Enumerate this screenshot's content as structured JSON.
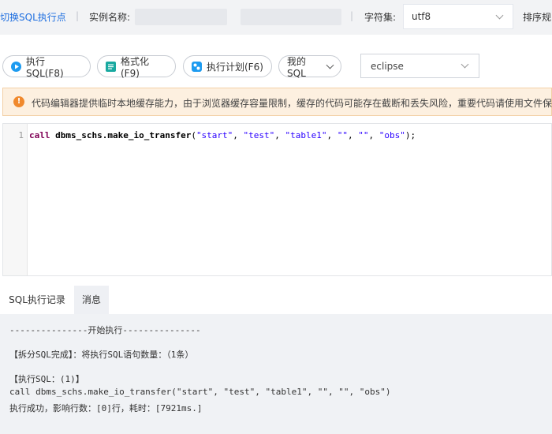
{
  "topbar": {
    "switch_link": "切换SQL执行点",
    "instance_label": "实例名称:",
    "charset_label": "字符集:",
    "charset_value": "utf8",
    "sort_label": "排序规"
  },
  "toolbar": {
    "execute": "执行SQL(F8)",
    "format": "格式化(F9)",
    "plan": "执行计划(F6)",
    "my_sql": "我的SQL",
    "theme_value": "eclipse"
  },
  "notice": {
    "text": "代码编辑器提供临时本地缓存能力，由于浏览器缓存容量限制，缓存的代码可能存在截断和丢失风险，重要代码请使用文件保"
  },
  "editor": {
    "line_number": "1",
    "code": {
      "kw": "call",
      "fn": "dbms_schs.make_io_transfer",
      "open": "(",
      "s1": "\"start\"",
      "s2": "\"test\"",
      "s3": "\"table1\"",
      "s4": "\"\"",
      "s5": "\"\"",
      "s6": "\"obs\"",
      "comma": ", ",
      "close": ");"
    }
  },
  "tabs": {
    "history": "SQL执行记录",
    "messages": "消息"
  },
  "console": {
    "line1": "---------------开始执行---------------",
    "line2": "【拆分SQL完成】：将执行SQL语句数量：（1条）",
    "line3": "【执行SQL：(1)】",
    "line4": "call dbms_schs.make_io_transfer(\"start\", \"test\", \"table1\", \"\", \"\", \"obs\")",
    "line5": "执行成功，影响行数：[0]行，耗时：[7921ms.]"
  },
  "colors": {
    "link": "#1f6fe0",
    "warning": "#f0892d",
    "execute_icon": "#1d9bf0",
    "format_icon": "#19a9a0"
  },
  "icons": [
    "play-icon",
    "format-icon",
    "plan-icon",
    "chevron-down-icon",
    "warning-icon"
  ]
}
